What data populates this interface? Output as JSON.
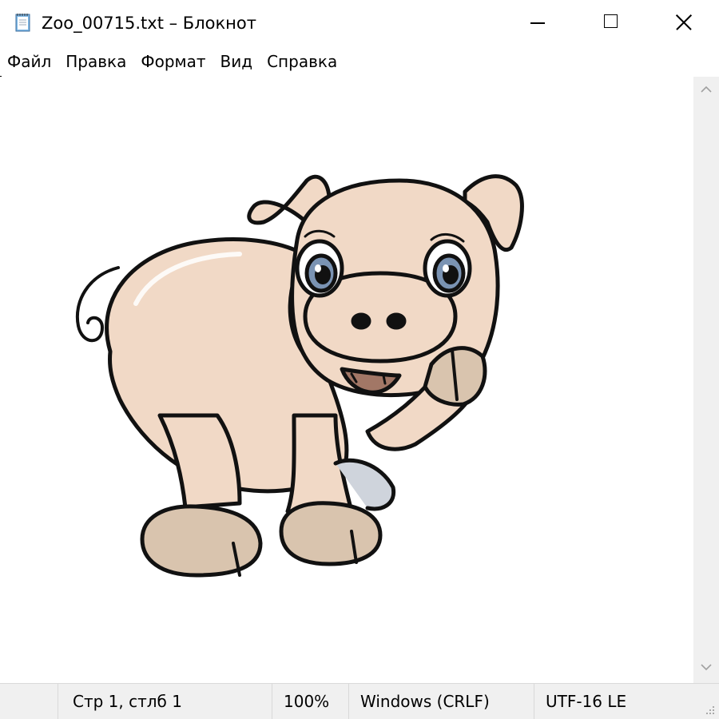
{
  "window": {
    "title": "Zoo_00715.txt – Блокнот",
    "app_icon": "notepad-icon",
    "controls": [
      "minimize-icon",
      "maximize-icon",
      "close-icon"
    ]
  },
  "menu": {
    "items": [
      {
        "label": "Файл"
      },
      {
        "label": "Правка"
      },
      {
        "label": "Формат"
      },
      {
        "label": "Вид"
      },
      {
        "label": "Справка"
      }
    ]
  },
  "editor": {
    "content_icon": "pig-icon",
    "colors": {
      "pig_fill": "#f1d9c6",
      "pig_outline": "#111111",
      "hoof_fill": "#d9c4ae",
      "eye_iris": "#7a93b3"
    }
  },
  "statusbar": {
    "position": "Стр 1, стлб 1",
    "zoom": "100%",
    "line_ending": "Windows (CRLF)",
    "encoding": "UTF-16 LE"
  }
}
